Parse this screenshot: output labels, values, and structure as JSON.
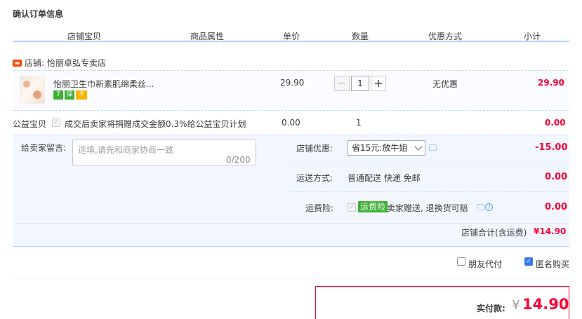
{
  "page": {
    "title": "确认订单信息"
  },
  "columns": [
    "店铺宝贝",
    "商品属性",
    "单价",
    "数量",
    "优惠方式",
    "小计"
  ],
  "shop": {
    "label": "店铺:",
    "name": "怡丽卓弘专卖店"
  },
  "item": {
    "title": "怡丽卫生巾新素肌绵柔丝...",
    "badges": [
      "7",
      "保",
      "卡"
    ],
    "price": "29.90",
    "quantity": "1",
    "minus_label": "−",
    "plus_label": "+",
    "discount": "无优惠",
    "subtotal": "29.90"
  },
  "charity": {
    "label": "公益宝贝",
    "text": "成交后卖家将捐赠成交金额0.3%给公益宝贝计划",
    "price": "0.00",
    "quantity": "1",
    "subtotal": "0.00"
  },
  "memo": {
    "label": "给卖家留言:",
    "placeholder": "选填,请先和商家协商一致",
    "count": "0/200"
  },
  "shop_discount": {
    "label": "店铺优惠:",
    "selected": "省15元:放牛姐",
    "value": "-15.00"
  },
  "shipping": {
    "label": "运送方式:",
    "text": "普通配送 快递 免邮",
    "value": "0.00"
  },
  "insurance": {
    "label": "运费险:",
    "tag": "运费险",
    "text": "卖家赠送, 退换货可赔",
    "value": "0.00"
  },
  "store_total": {
    "label": "店铺合计(含运费)",
    "value": "¥14.90"
  },
  "options": {
    "friend_pay": {
      "label": "朋友代付",
      "checked": false
    },
    "anonymous": {
      "label": "匿名购买",
      "checked": true
    }
  },
  "payment": {
    "label": "实付款:",
    "currency": "¥",
    "value": "14.90"
  },
  "colors": {
    "accent_red": "#ff0036",
    "accent_blue": "#b2d1ff",
    "panel_bg": "#f2f7ff",
    "tag_green": "#3cb035"
  }
}
